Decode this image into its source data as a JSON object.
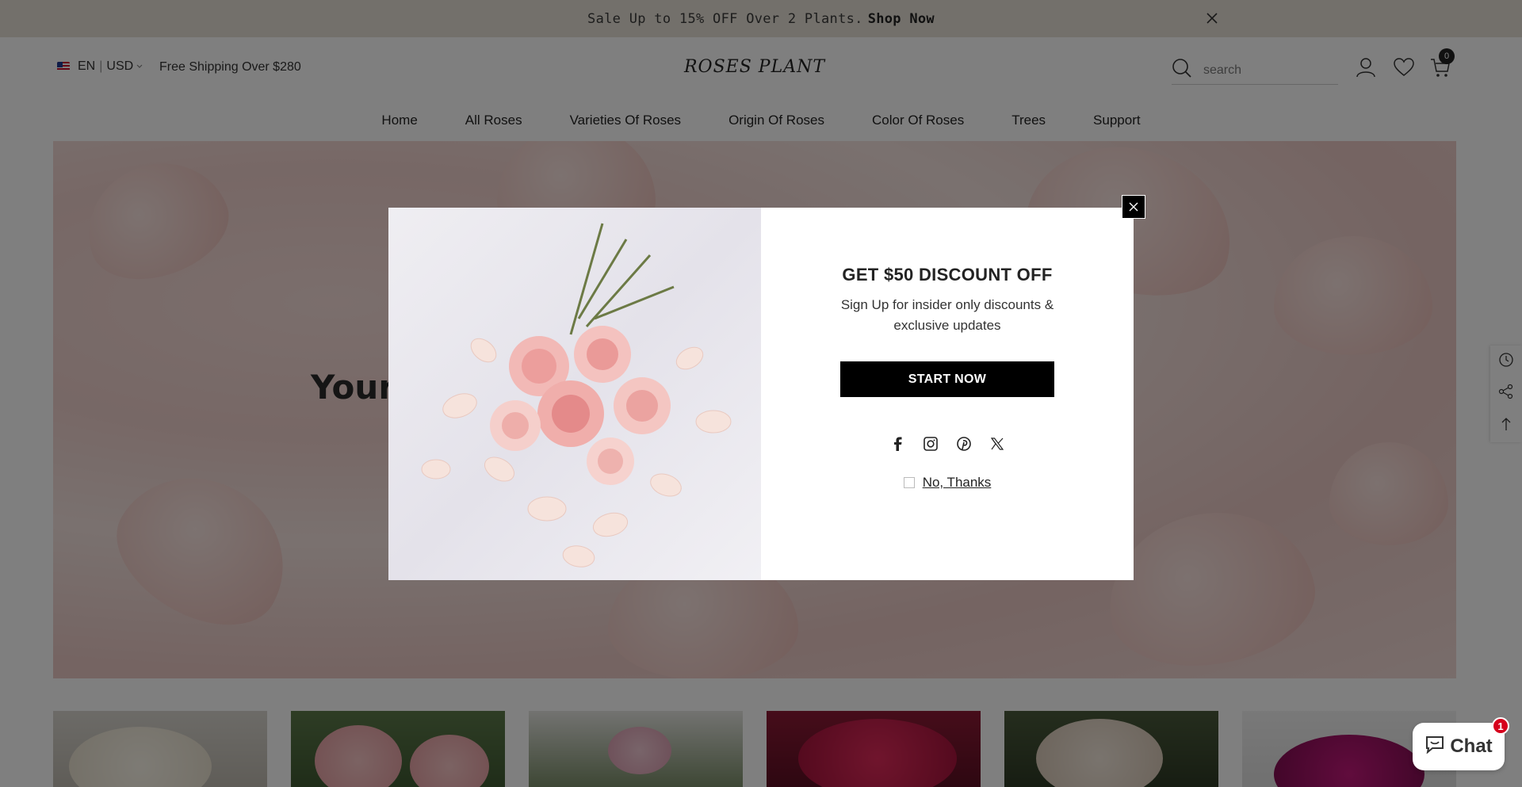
{
  "announcement": {
    "text": "Sale Up to 15% OFF Over 2 Plants.",
    "link": "Shop Now"
  },
  "header": {
    "language": "EN",
    "currency": "USD",
    "free_shipping": "Free Shipping Over $280",
    "logo_left": "ROSES",
    "logo_right": "PLANT",
    "search_placeholder": "search",
    "cart_count": "0"
  },
  "nav": {
    "items": [
      "Home",
      "All Roses",
      "Varieties Of Roses",
      "Origin Of Roses",
      "Color Of Roses",
      "Trees",
      "Support"
    ]
  },
  "hero": {
    "heading_visible": "Your"
  },
  "popup": {
    "title": "GET $50 DISCOUNT OFF",
    "subtitle": "Sign Up for insider only discounts & exclusive updates",
    "button": "START NOW",
    "no_thanks": "No, Thanks"
  },
  "chat": {
    "label": "Chat",
    "badge": "1"
  },
  "colors": {
    "announcement_bg": "#e6e1d6",
    "button_bg": "#000000",
    "overlay": "rgba(0,0,0,0.5)",
    "badge": "#d6001c"
  },
  "icons": [
    "close-icon",
    "search-icon",
    "account-icon",
    "wishlist-icon",
    "cart-icon",
    "recently-viewed-icon",
    "share-icon",
    "back-to-top-icon",
    "facebook-icon",
    "instagram-icon",
    "pinterest-icon",
    "x-twitter-icon",
    "chat-bubble-icon"
  ]
}
